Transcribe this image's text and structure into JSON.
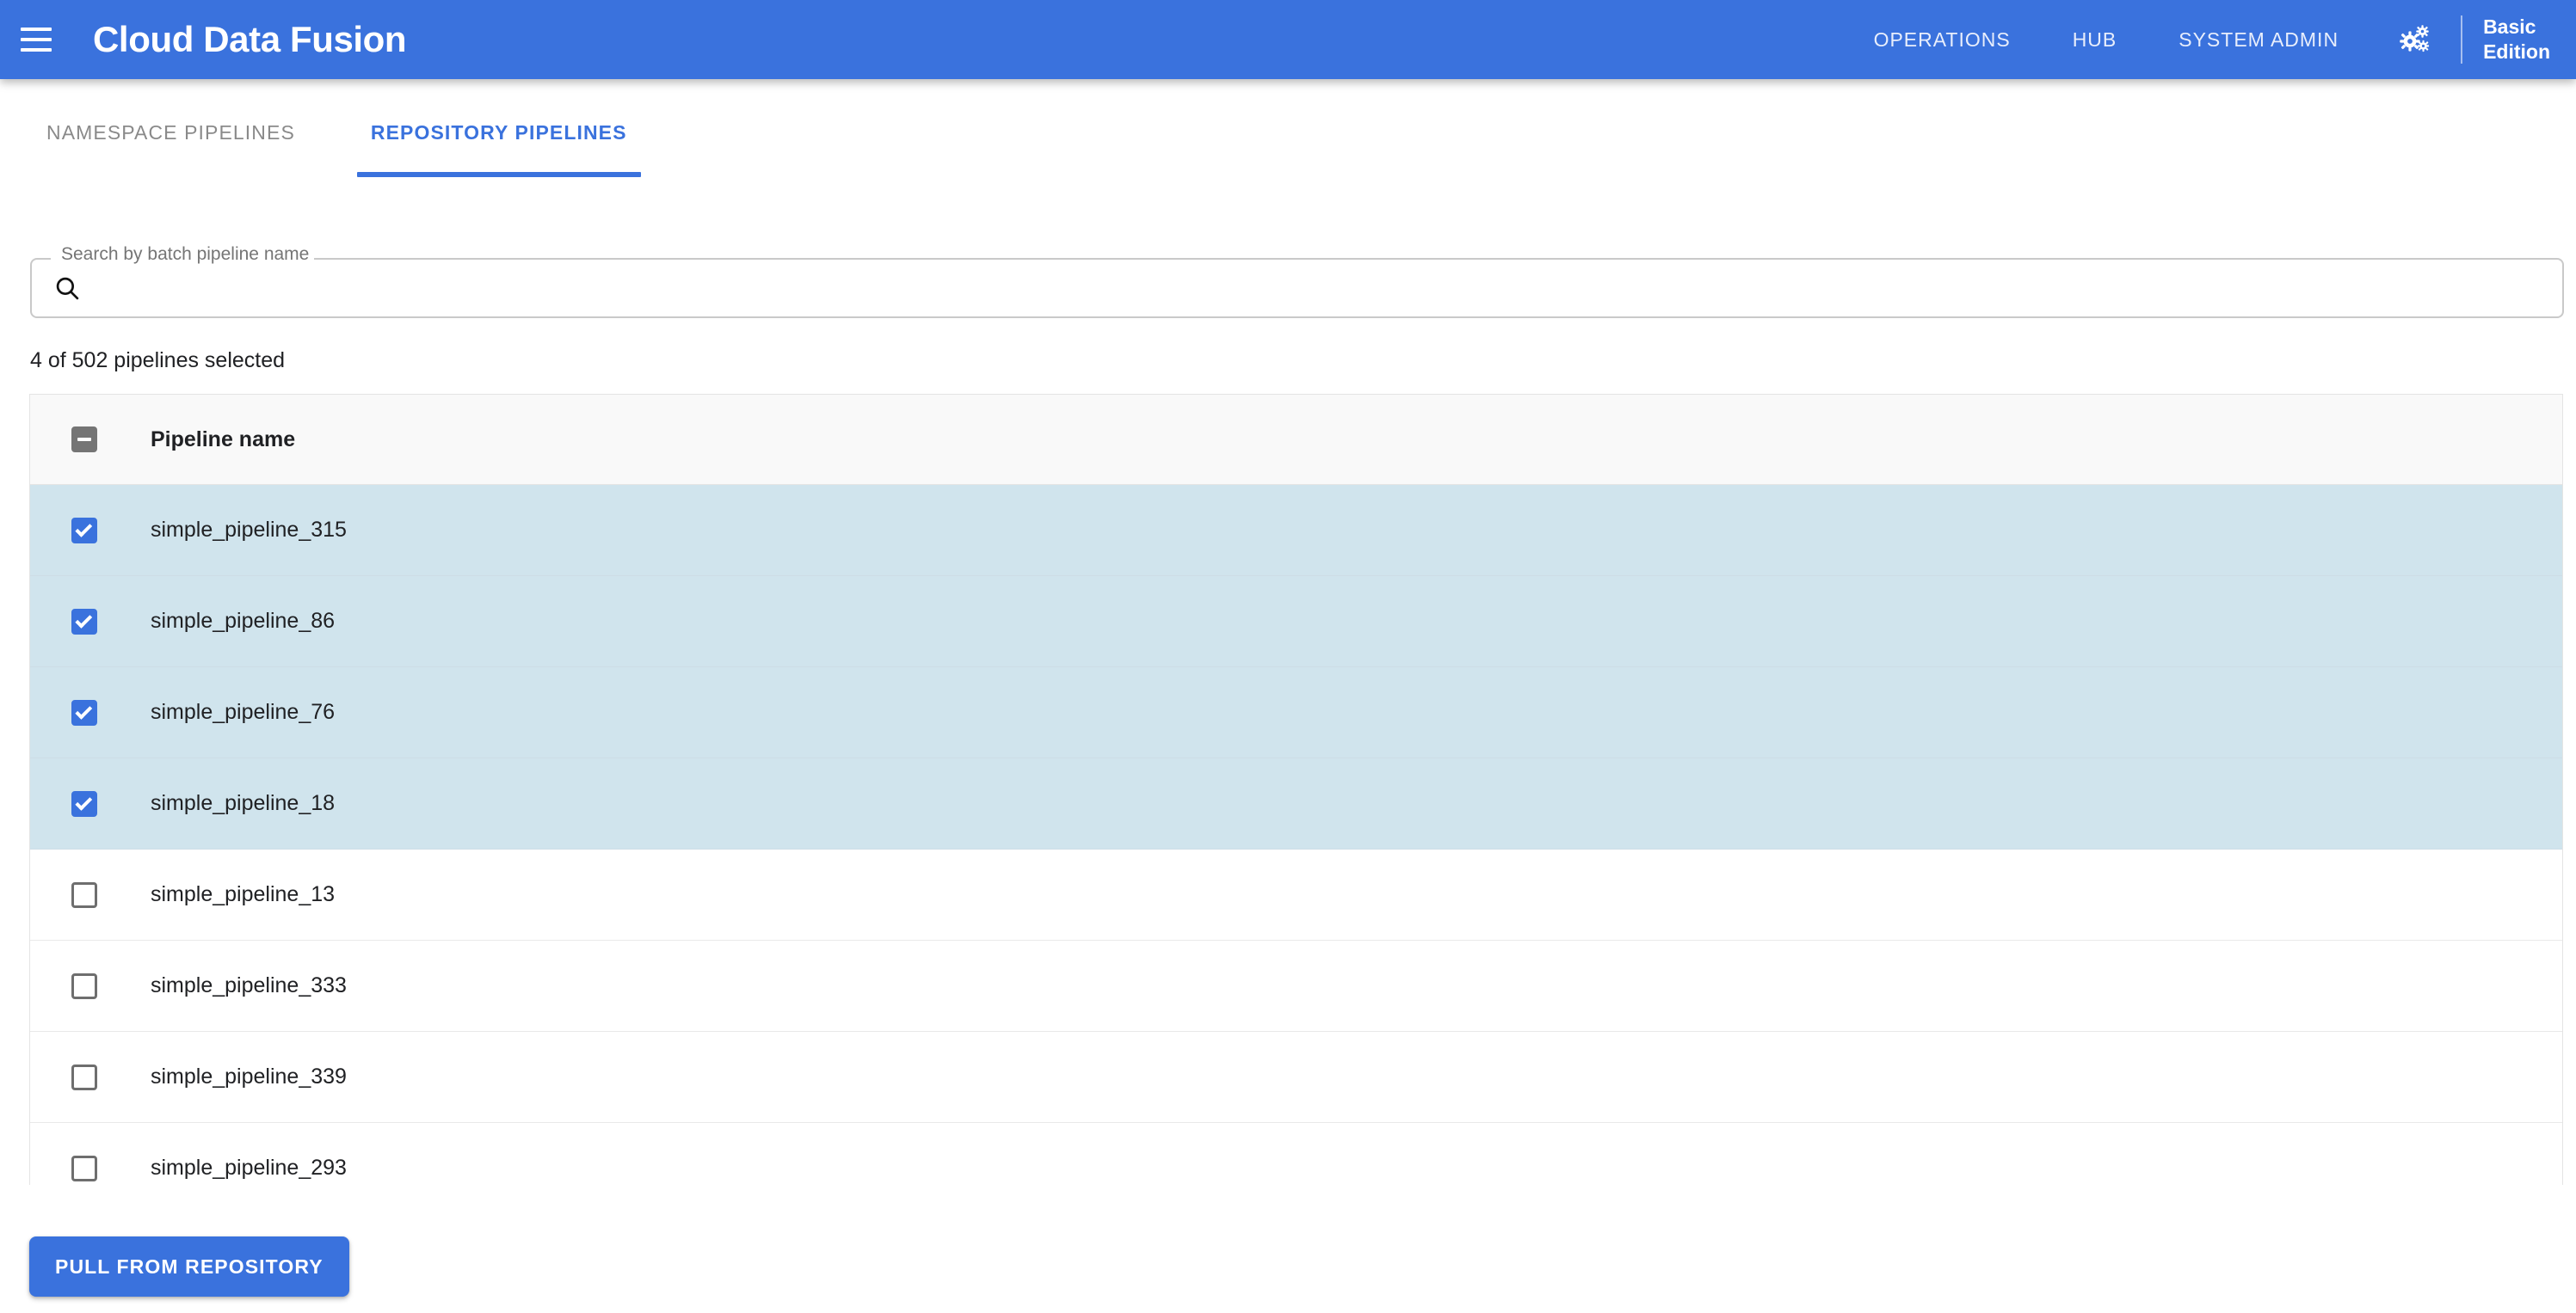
{
  "toolbar": {
    "menu_icon": "hamburger-menu-icon",
    "brand": "Cloud Data Fusion",
    "nav": [
      {
        "label": "OPERATIONS"
      },
      {
        "label": "HUB"
      },
      {
        "label": "SYSTEM ADMIN"
      }
    ],
    "gear_icon": "gears-settings-icon",
    "edition_line1": "Basic",
    "edition_line2": "Edition",
    "background_color": "#3a72dd"
  },
  "tabs": [
    {
      "label": "NAMESPACE PIPELINES",
      "active": false
    },
    {
      "label": "REPOSITORY PIPELINES",
      "active": true
    }
  ],
  "search": {
    "label": "Search by batch pipeline name",
    "value": "",
    "placeholder": "",
    "icon": "search-icon"
  },
  "selection_summary": "4 of 502 pipelines selected",
  "table": {
    "select_all_state": "indeterminate",
    "columns": [
      "Pipeline name"
    ],
    "rows": [
      {
        "name": "simple_pipeline_315",
        "selected": true
      },
      {
        "name": "simple_pipeline_86",
        "selected": true
      },
      {
        "name": "simple_pipeline_76",
        "selected": true
      },
      {
        "name": "simple_pipeline_18",
        "selected": true
      },
      {
        "name": "simple_pipeline_13",
        "selected": false
      },
      {
        "name": "simple_pipeline_333",
        "selected": false
      },
      {
        "name": "simple_pipeline_339",
        "selected": false
      },
      {
        "name": "simple_pipeline_293",
        "selected": false
      }
    ]
  },
  "actions": {
    "pull_label": "PULL FROM REPOSITORY"
  },
  "colors": {
    "accent": "#3a72dd",
    "selected_row": "#d0e4ed",
    "header_row": "#f9f9f9",
    "text": "#202124",
    "muted_text": "#8a8a8a"
  }
}
